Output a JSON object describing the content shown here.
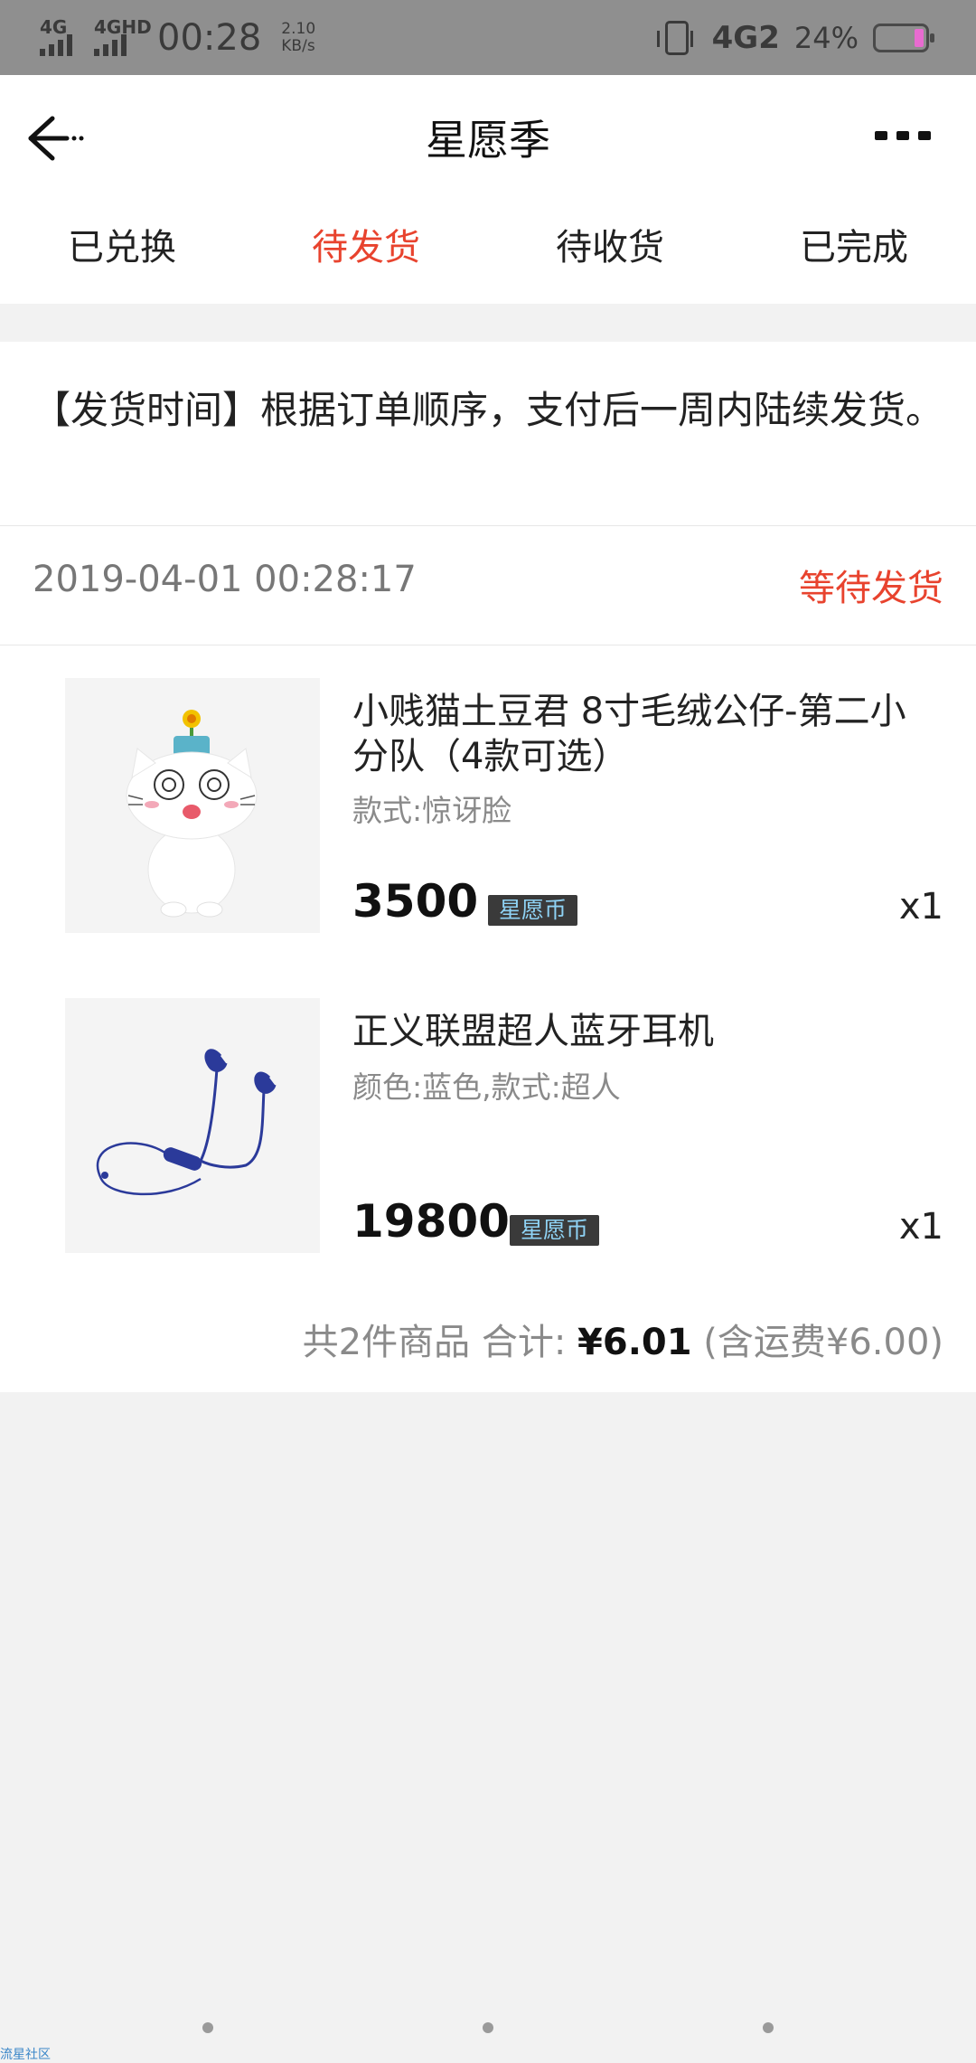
{
  "status_bar": {
    "signal1": "4G",
    "signal2": "4GHD",
    "time": "00:28",
    "speed_value": "2.10",
    "speed_unit": "KB/s",
    "network": "4G2",
    "battery": "24%",
    "battery_color": "#e86bd0"
  },
  "header": {
    "title": "星愿季",
    "back_icon": "back-arrow-icon",
    "more_icon": "more-dots-icon"
  },
  "tabs": [
    {
      "label": "已兑换",
      "active": false
    },
    {
      "label": "待发货",
      "active": true
    },
    {
      "label": "待收货",
      "active": false
    },
    {
      "label": "已完成",
      "active": false
    }
  ],
  "notice": {
    "text": "【发货时间】根据订单顺序，支付后一周内陆续发货。"
  },
  "order": {
    "datetime": "2019-04-01 00:28:17",
    "status": "等待发货",
    "items": [
      {
        "name": "小贱猫土豆君 8寸毛绒公仔-第二小分队（4款可选）",
        "spec": "款式:惊讶脸",
        "price": "3500",
        "currency": "星愿币",
        "qty": "x1"
      },
      {
        "name": "正义联盟超人蓝牙耳机",
        "spec": "颜色:蓝色,款式:超人",
        "price": "19800",
        "currency": "星愿币",
        "qty": "x1"
      }
    ],
    "summary": {
      "count_text": "共2件商品 合计: ",
      "total": "¥6.01",
      "shipping_text": " (含运费¥6.00)"
    }
  },
  "colors": {
    "accent": "#e8432e",
    "coin_badge_bg": "#3a3a3a",
    "coin_badge_text": "#8fd3f5"
  },
  "watermark": "流星社区"
}
